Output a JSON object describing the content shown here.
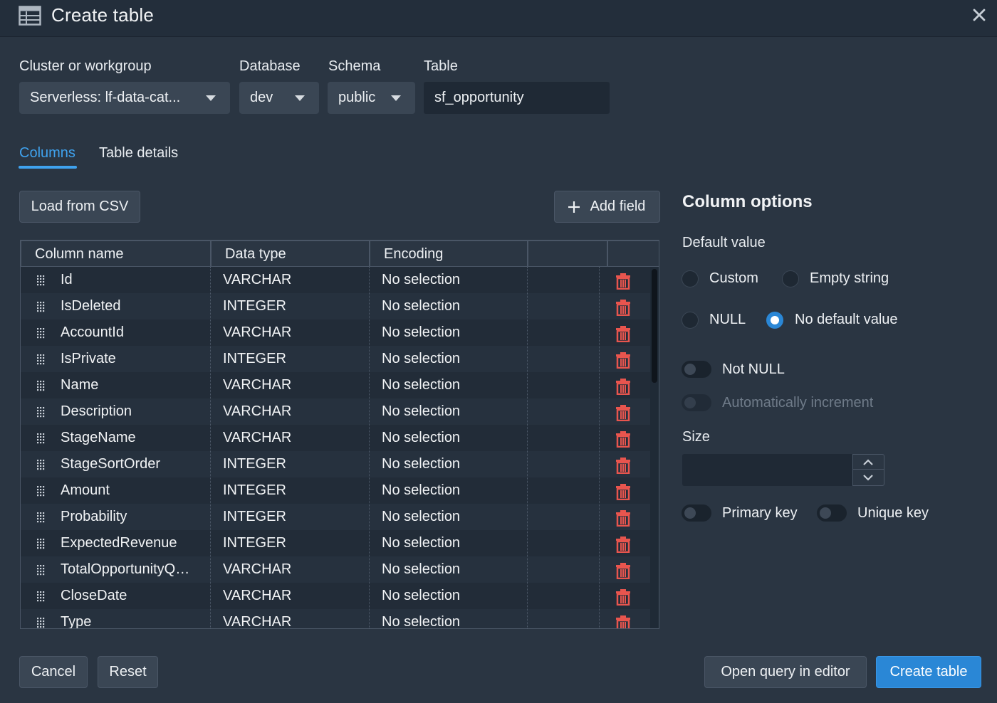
{
  "dialog": {
    "title": "Create table",
    "icon": "table-icon",
    "close_icon": "close-icon"
  },
  "fields": {
    "cluster": {
      "label": "Cluster or workgroup",
      "value": "Serverless: lf-data-cat..."
    },
    "database": {
      "label": "Database",
      "value": "dev"
    },
    "schema": {
      "label": "Schema",
      "value": "public"
    },
    "table": {
      "label": "Table",
      "value": "sf_opportunity"
    }
  },
  "tabs": [
    {
      "label": "Columns",
      "active": true
    },
    {
      "label": "Table details",
      "active": false
    }
  ],
  "toolbar": {
    "load_csv": "Load from CSV",
    "add_field": "Add field"
  },
  "grid": {
    "headers": [
      "Column name",
      "Data type",
      "Encoding"
    ],
    "rows": [
      {
        "name": "Id",
        "type": "VARCHAR",
        "encoding": "No selection"
      },
      {
        "name": "IsDeleted",
        "type": "INTEGER",
        "encoding": "No selection"
      },
      {
        "name": "AccountId",
        "type": "VARCHAR",
        "encoding": "No selection"
      },
      {
        "name": "IsPrivate",
        "type": "INTEGER",
        "encoding": "No selection"
      },
      {
        "name": "Name",
        "type": "VARCHAR",
        "encoding": "No selection"
      },
      {
        "name": "Description",
        "type": "VARCHAR",
        "encoding": "No selection"
      },
      {
        "name": "StageName",
        "type": "VARCHAR",
        "encoding": "No selection"
      },
      {
        "name": "StageSortOrder",
        "type": "INTEGER",
        "encoding": "No selection"
      },
      {
        "name": "Amount",
        "type": "INTEGER",
        "encoding": "No selection"
      },
      {
        "name": "Probability",
        "type": "INTEGER",
        "encoding": "No selection"
      },
      {
        "name": "ExpectedRevenue",
        "type": "INTEGER",
        "encoding": "No selection"
      },
      {
        "name": "TotalOpportunityQ…",
        "type": "VARCHAR",
        "encoding": "No selection"
      },
      {
        "name": "CloseDate",
        "type": "VARCHAR",
        "encoding": "No selection"
      },
      {
        "name": "Type",
        "type": "VARCHAR",
        "encoding": "No selection"
      }
    ]
  },
  "options": {
    "title": "Column options",
    "default_value_label": "Default value",
    "radios": {
      "custom": "Custom",
      "empty_string": "Empty string",
      "null": "NULL",
      "no_default": "No default value"
    },
    "selected_default": "No default value",
    "not_null": "Not NULL",
    "auto_increment": "Automatically increment",
    "size_label": "Size",
    "size_value": "",
    "primary_key": "Primary key",
    "unique_key": "Unique key"
  },
  "footer": {
    "cancel": "Cancel",
    "reset": "Reset",
    "open_query": "Open query in editor",
    "create": "Create table"
  },
  "colors": {
    "accent": "#2a87d6",
    "link": "#3fa2ee",
    "delete": "#e8554e"
  }
}
